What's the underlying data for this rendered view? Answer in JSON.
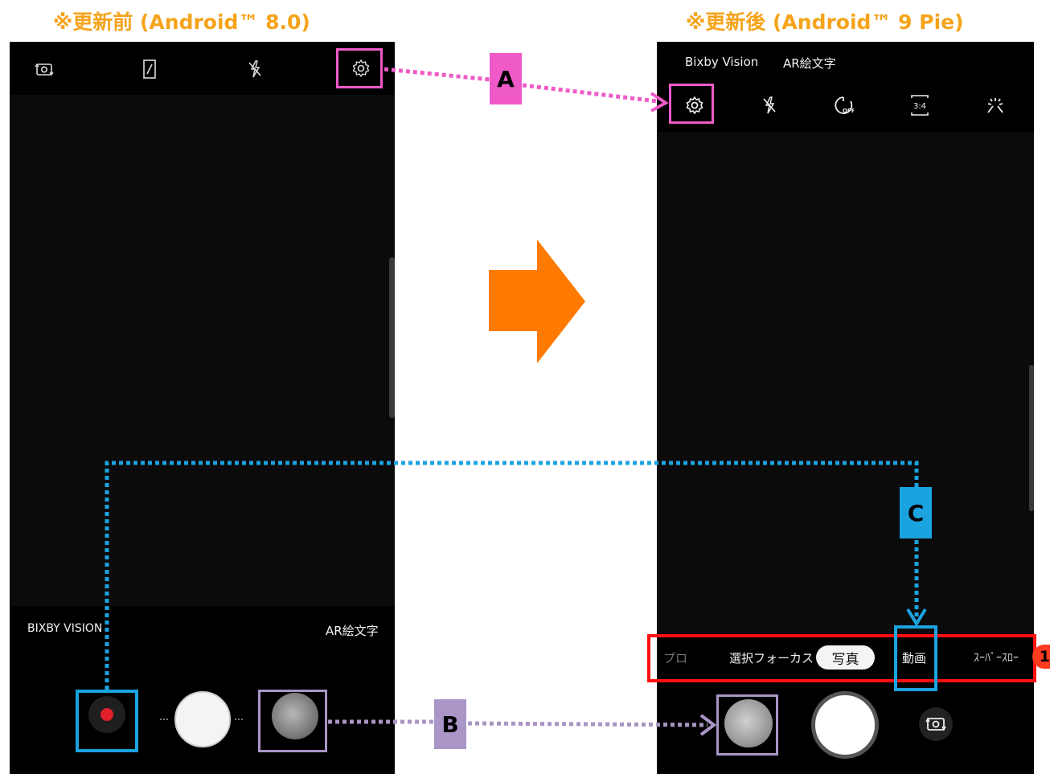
{
  "headings": {
    "before": "※更新前 (Android™ 8.0)",
    "after": "※更新後 (Android™ 9 Pie)"
  },
  "before_screen": {
    "top_icons": [
      "camera-switch-icon",
      "aspect-ratio-icon",
      "flash-off-icon",
      "settings-icon"
    ],
    "bixby_label": "BIXBY VISION",
    "ar_label": "AR絵文字",
    "bottom_buttons": [
      "record-button",
      "shutter-button",
      "gallery-thumbnail"
    ]
  },
  "after_screen": {
    "mode_links": [
      "Bixby Vision",
      "AR絵文字"
    ],
    "top_icons": [
      "settings-icon",
      "flash-off-icon",
      "timer-off-icon",
      "ratio-3-4-icon",
      "effects-icon"
    ],
    "ratio_text": "3:4",
    "modes": [
      "プロ",
      "選択フォーカス",
      "写真",
      "動画",
      "ｽｰﾊﾟｰｽﾛｰ"
    ],
    "selected_mode": "写真",
    "bottom_buttons": [
      "gallery-thumbnail",
      "shutter-button",
      "camera-switch-button"
    ]
  },
  "annotations": {
    "a": "A",
    "b": "B",
    "c": "C",
    "badge": "1"
  },
  "colors": {
    "heading": "#f5a31a",
    "arrow": "#ff7a00",
    "pink": "#f05ac8",
    "blue": "#1ba3e0",
    "purple": "#a995c6",
    "red": "#ff1010",
    "badge": "#ff3b1f"
  }
}
